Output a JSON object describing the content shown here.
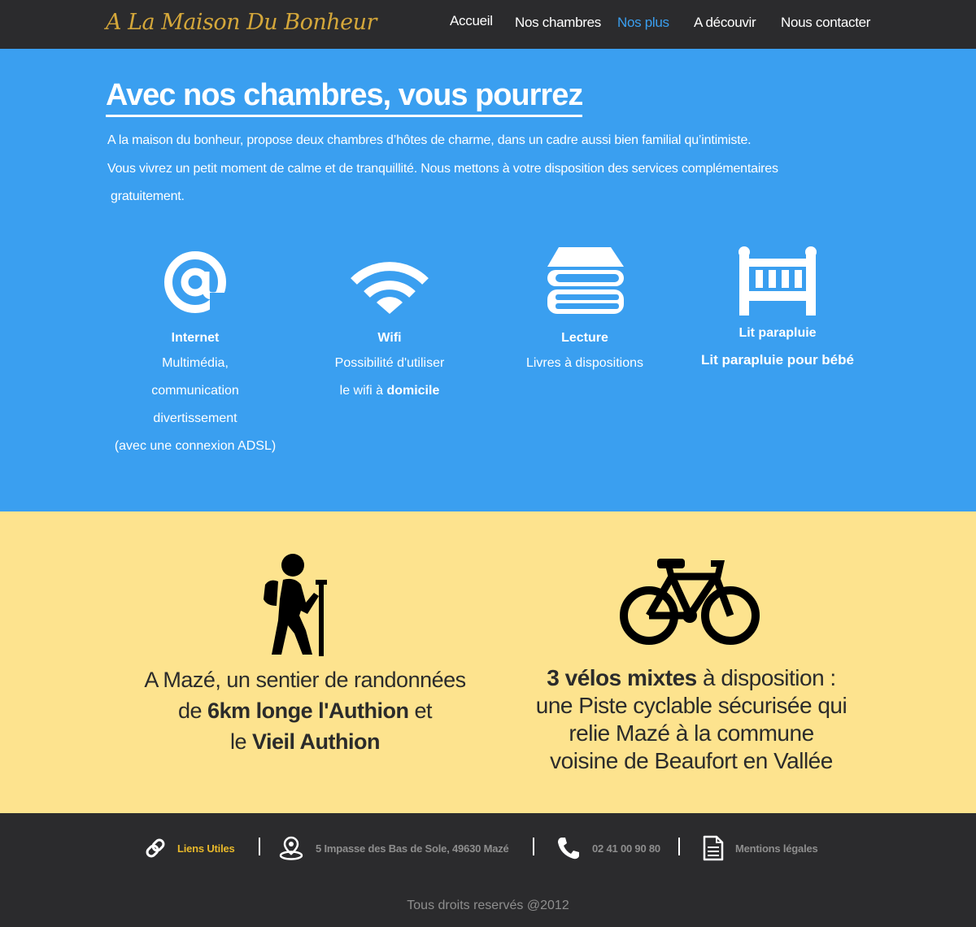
{
  "brand": {
    "logo": "A La Maison Du Bonheur"
  },
  "nav": {
    "items": [
      "Accueil",
      "Nos chambres",
      "Nos plus",
      "A découvir",
      "Nous contacter"
    ],
    "active": "Nos plus"
  },
  "services": {
    "title": "Avec nos chambres, vous pourrez",
    "intro_line1": "A la maison du bonheur, propose deux chambres d’hôtes de charme, dans un cadre aussi bien familial qu’intimiste.",
    "intro_line2": "Vous vivrez un petit moment de calme et de tranquillité. Nous mettons à votre disposition des services complémentaires",
    "intro_line3": "gratuitement.",
    "features": [
      {
        "icon": "at-sign-icon",
        "name": "Internet",
        "lines": [
          "Multimédia,",
          "communication",
          "divertissement",
          "(avec une connexion ADSL)"
        ]
      },
      {
        "icon": "wifi-icon",
        "name": "Wifi",
        "line1": "Possibilité d'utiliser",
        "line2_prefix": "le wifi à ",
        "line2_bold": "domicile"
      },
      {
        "icon": "books-icon",
        "name": "Lecture",
        "lines": [
          "Livres à dispositions"
        ]
      },
      {
        "icon": "crib-icon",
        "name": "Lit parapluie",
        "bold_line": "Lit parapluie pour bébé"
      }
    ]
  },
  "activities": {
    "hiking": {
      "icon": "hiker-icon",
      "line1": "A Mazé,  un sentier de randonnées",
      "line2_prefix": "de ",
      "line2_bold": "6km longe l'Authion",
      "line2_suffix": " et",
      "line3_prefix": "le ",
      "line3_bold": "Vieil Authion"
    },
    "cycling": {
      "icon": "bicycle-icon",
      "line1_bold": "3 vélos mixtes",
      "line1_suffix": " à disposition :",
      "line2": "une Piste cyclable sécurisée qui",
      "line3": "relie Mazé  à la commune",
      "line4": "voisine de Beaufort en Vallée"
    }
  },
  "footer": {
    "links_label": "Liens Utiles",
    "address": "5 Impasse des Bas de Sole, 49630 Mazé",
    "phone": "02 41 00 90 80",
    "legal": "Mentions légales",
    "copyright": "Tous droits reservés @2012"
  },
  "colors": {
    "accent": "#3a9ff0",
    "logo": "#d4a73a",
    "yellow": "#fde38e",
    "dark": "#2b2b2d",
    "link_yellow": "#e8b82a"
  }
}
